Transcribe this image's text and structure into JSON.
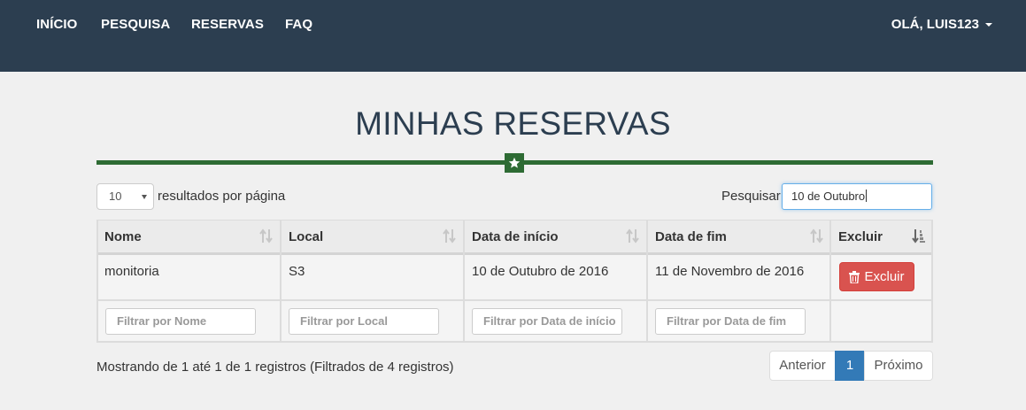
{
  "nav": {
    "links": [
      "INÍCIO",
      "PESQUISA",
      "RESERVAS",
      "FAQ"
    ],
    "user": "OLÁ, LUIS123"
  },
  "page": {
    "title": "MINHAS RESERVAS"
  },
  "table_controls": {
    "page_length": "10",
    "page_length_label": "resultados por página",
    "search_label": "Pesquisar",
    "search_value": "10 de Outubro"
  },
  "table": {
    "columns": [
      "Nome",
      "Local",
      "Data de início",
      "Data de fim",
      "Excluir"
    ],
    "rows": [
      {
        "nome": "monitoria",
        "local": "S3",
        "inicio": "10 de Outubro de 2016",
        "fim": "11 de Novembro de 2016",
        "action": "Excluir"
      }
    ],
    "filters": [
      "Filtrar por Nome",
      "Filtrar por Local",
      "Filtrar por Data de início",
      "Filtrar por Data de fim"
    ]
  },
  "footer": {
    "info": "Mostrando de 1 até 1 de 1 registros (Filtrados de 4 registros)",
    "prev": "Anterior",
    "current_page": "1",
    "next": "Próximo"
  },
  "colors": {
    "navbar": "#2c3e50",
    "divider": "#2e6b34",
    "danger": "#d9534f",
    "primary": "#337ab7"
  },
  "icons": {
    "divider": "star-icon",
    "sort": "sort-icon",
    "sort_active": "sort-ascending-icon",
    "delete": "trash-icon",
    "user_menu": "caret-down-icon"
  }
}
